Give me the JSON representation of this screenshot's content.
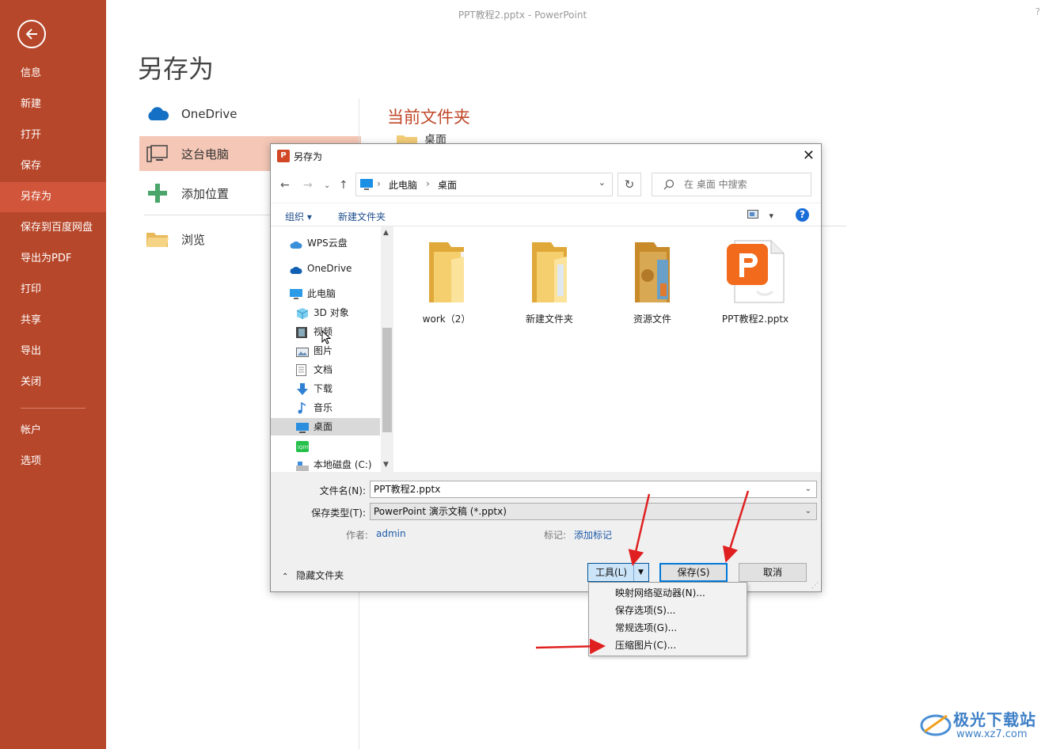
{
  "window": {
    "title": "PPT教程2.pptx - PowerPoint",
    "help": "?"
  },
  "sidebar": {
    "items": [
      {
        "label": "信息"
      },
      {
        "label": "新建"
      },
      {
        "label": "打开"
      },
      {
        "label": "保存"
      },
      {
        "label": "另存为",
        "active": true
      },
      {
        "label": "保存到百度网盘"
      },
      {
        "label": "导出为PDF"
      },
      {
        "label": "打印"
      },
      {
        "label": "共享"
      },
      {
        "label": "导出"
      },
      {
        "label": "关闭"
      },
      {
        "label": "帐户"
      },
      {
        "label": "选项"
      }
    ],
    "bg_color": "#b7472a",
    "active_color": "#d0553a"
  },
  "page": {
    "title": "另存为"
  },
  "locations": [
    {
      "label": "OneDrive",
      "icon": "cloud-icon"
    },
    {
      "label": "这台电脑",
      "icon": "computer-icon",
      "active": true
    },
    {
      "label": "添加位置",
      "icon": "plus-icon"
    },
    {
      "label": "浏览",
      "icon": "folder-icon"
    }
  ],
  "current_folder": {
    "heading": "当前文件夹",
    "item": "桌面"
  },
  "dialog": {
    "title": "另存为",
    "close": "✕",
    "address": {
      "parts": [
        "此电脑",
        "桌面"
      ]
    },
    "search_placeholder": "在 桌面 中搜索",
    "toolbar": {
      "organize": "组织 ▾",
      "new_folder": "新建文件夹",
      "help": "?"
    },
    "tree": [
      {
        "label": "WPS云盘",
        "icon": "wps-cloud-icon"
      },
      {
        "label": "OneDrive",
        "icon": "onedrive-icon"
      },
      {
        "label": "此电脑",
        "icon": "pc-icon"
      },
      {
        "label": "3D 对象",
        "icon": "3d-objects-icon"
      },
      {
        "label": "视频",
        "icon": "video-icon"
      },
      {
        "label": "图片",
        "icon": "pictures-icon"
      },
      {
        "label": "文档",
        "icon": "documents-icon"
      },
      {
        "label": "下载",
        "icon": "download-icon"
      },
      {
        "label": "音乐",
        "icon": "music-icon"
      },
      {
        "label": "桌面",
        "icon": "desktop-icon",
        "selected": true
      },
      {
        "label": "",
        "icon": "iqiyi-icon"
      },
      {
        "label": "本地磁盘 (C:)",
        "icon": "disk-icon"
      }
    ],
    "files": [
      {
        "name": "work（2）",
        "type": "folder"
      },
      {
        "name": "新建文件夹",
        "type": "folder"
      },
      {
        "name": "资源文件",
        "type": "folder-special"
      },
      {
        "name": "PPT教程2.pptx",
        "type": "pptx"
      }
    ],
    "fields": {
      "filename_label": "文件名(N):",
      "filename_value": "PPT教程2.pptx",
      "type_label": "保存类型(T):",
      "type_value": "PowerPoint 演示文稿 (*.pptx)",
      "author_label": "作者:",
      "author_value": "admin",
      "tags_label": "标记:",
      "tags_value": "添加标记"
    },
    "hide_folders": "隐藏文件夹",
    "buttons": {
      "tools": "工具(L)",
      "save": "保存(S)",
      "cancel": "取消"
    }
  },
  "tools_menu": {
    "items": [
      "映射网络驱动器(N)...",
      "保存选项(S)...",
      "常规选项(G)...",
      "压缩图片(C)..."
    ]
  },
  "watermark": {
    "text": "极光下载站",
    "url": "www.xz7.com"
  }
}
